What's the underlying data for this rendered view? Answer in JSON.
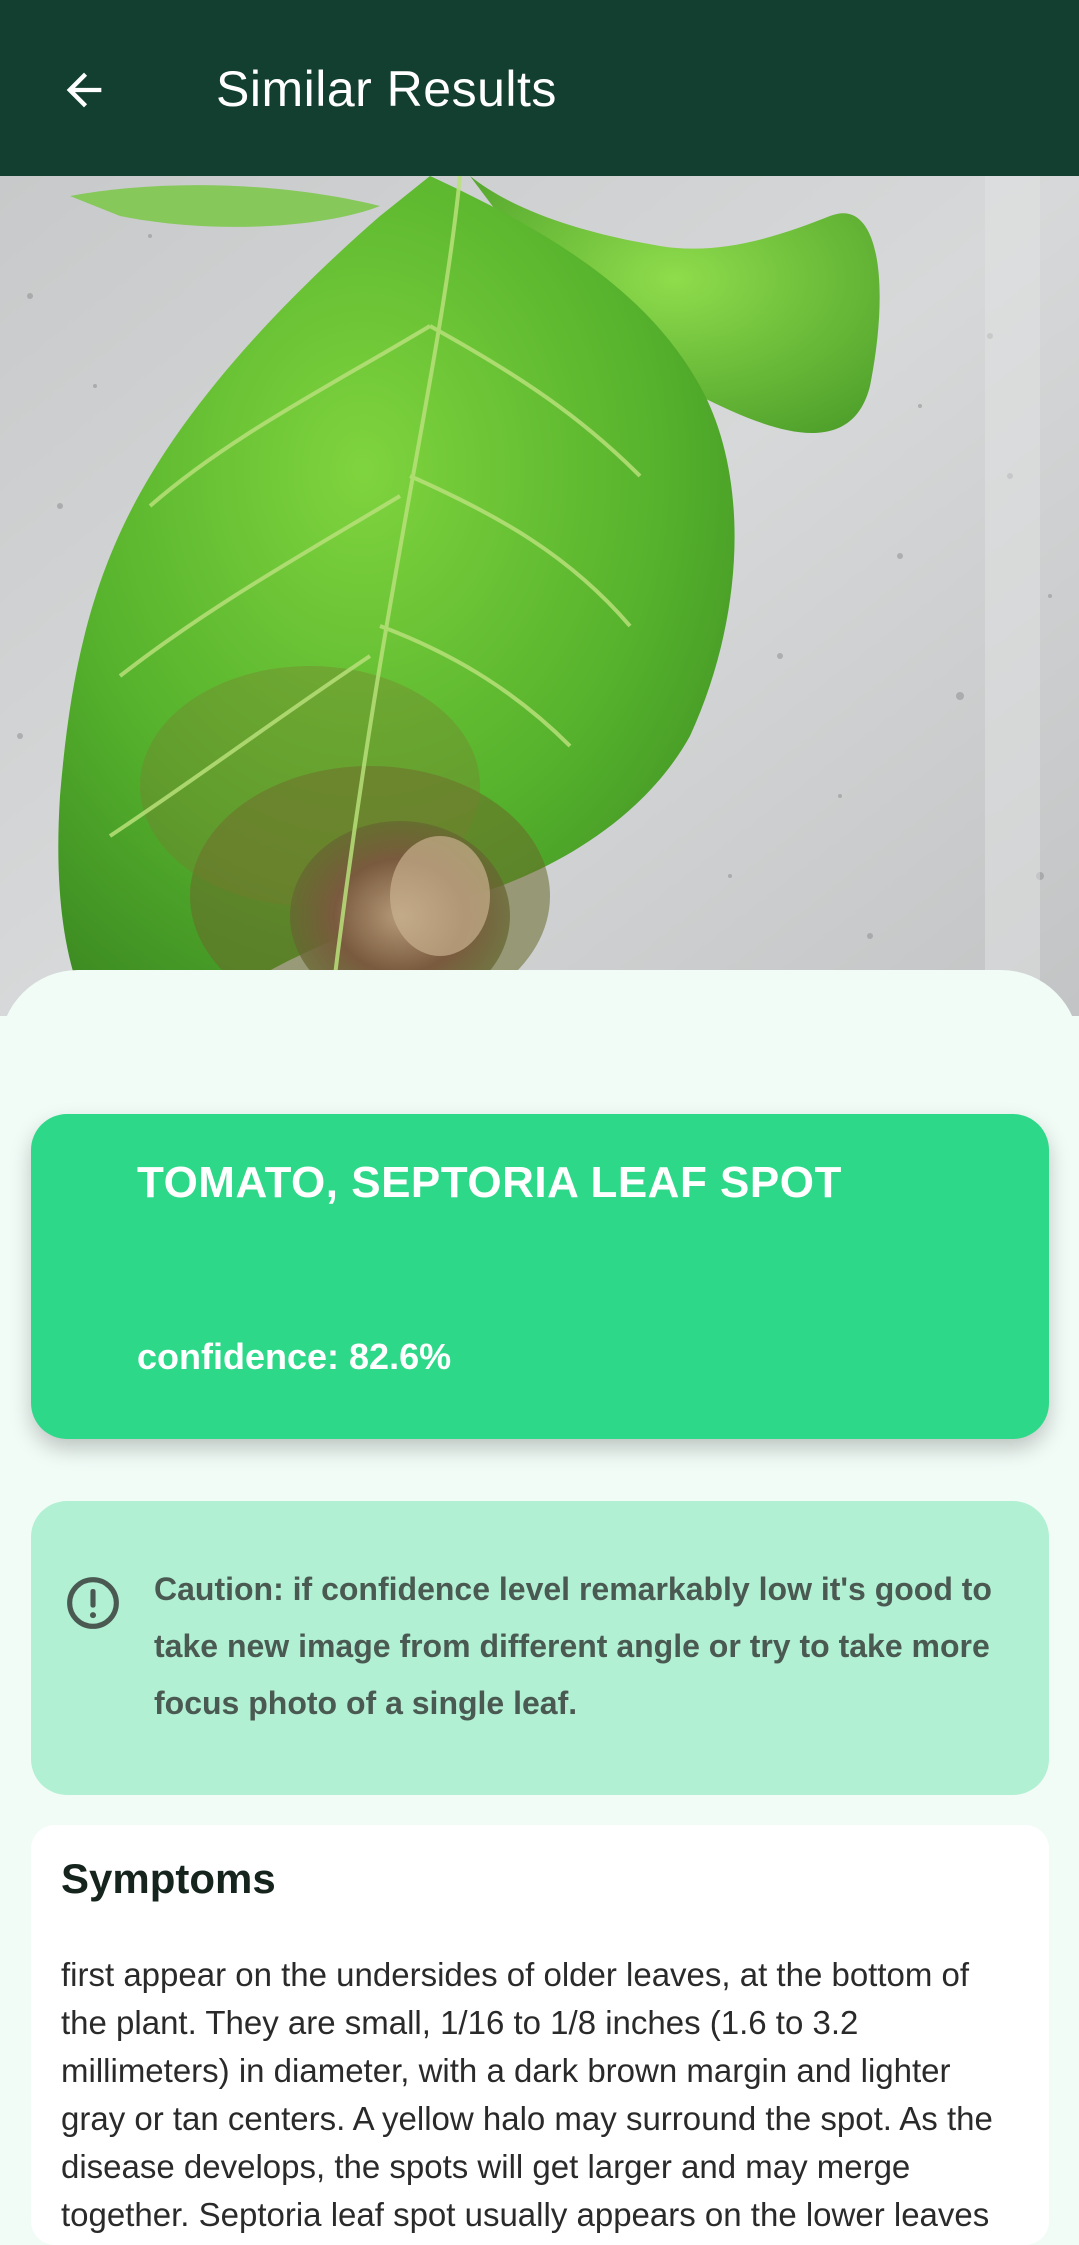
{
  "appbar": {
    "title": "Similar Results",
    "back_icon": "arrow-left-icon"
  },
  "photo": {
    "alt": "tomato leaf with septoria leaf spot"
  },
  "result": {
    "disease_name": "TOMATO, SEPTORIA LEAF SPOT",
    "confidence_label": "confidence: 82.6%",
    "confidence_value": 82.6
  },
  "caution": {
    "icon": "exclamation-circle-icon",
    "text": "Caution: if confidence level remarkably low it's good to take new image from different angle or try to take more focus photo of a single leaf."
  },
  "symptoms": {
    "heading": "Symptoms",
    "body": "first appear on the undersides of older leaves, at the bottom of the plant. They are small, 1/16 to 1/8 inches (1.6 to 3.2 millimeters) in diameter, with a dark brown margin and lighter gray or tan centers. A yellow halo may surround the spot. As the disease develops, the spots will get larger and may merge together. Septoria leaf spot usually appears on the lower leaves"
  },
  "colors": {
    "appbar": "#123f2f",
    "result_card": "#2ed889",
    "caution_card": "#b1f0d3",
    "background": "#f2fcf7"
  }
}
